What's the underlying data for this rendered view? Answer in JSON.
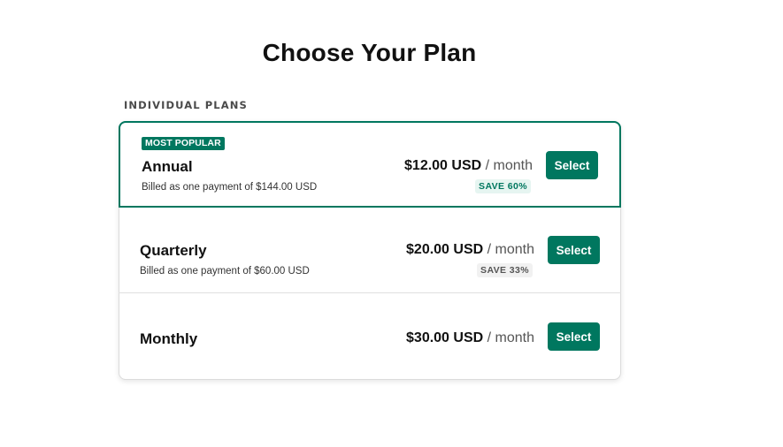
{
  "header": {
    "title": "Choose Your Plan"
  },
  "section": {
    "label": "INDIVIDUAL PLANS"
  },
  "colors": {
    "accent": "#00775f",
    "save_bg": "#e6f5f1"
  },
  "plans": [
    {
      "badge": "MOST POPULAR",
      "name": "Annual",
      "billed": "Billed as one payment of $144.00 USD",
      "price": "$12.00 USD",
      "period": " / month",
      "save": "SAVE 60%",
      "button": "Select",
      "selected": true
    },
    {
      "name": "Quarterly",
      "billed": "Billed as one payment of $60.00 USD",
      "price": "$20.00 USD",
      "period": " / month",
      "save": "SAVE 33%",
      "button": "Select"
    },
    {
      "name": "Monthly",
      "price": "$30.00 USD",
      "period": " / month",
      "button": "Select"
    }
  ]
}
